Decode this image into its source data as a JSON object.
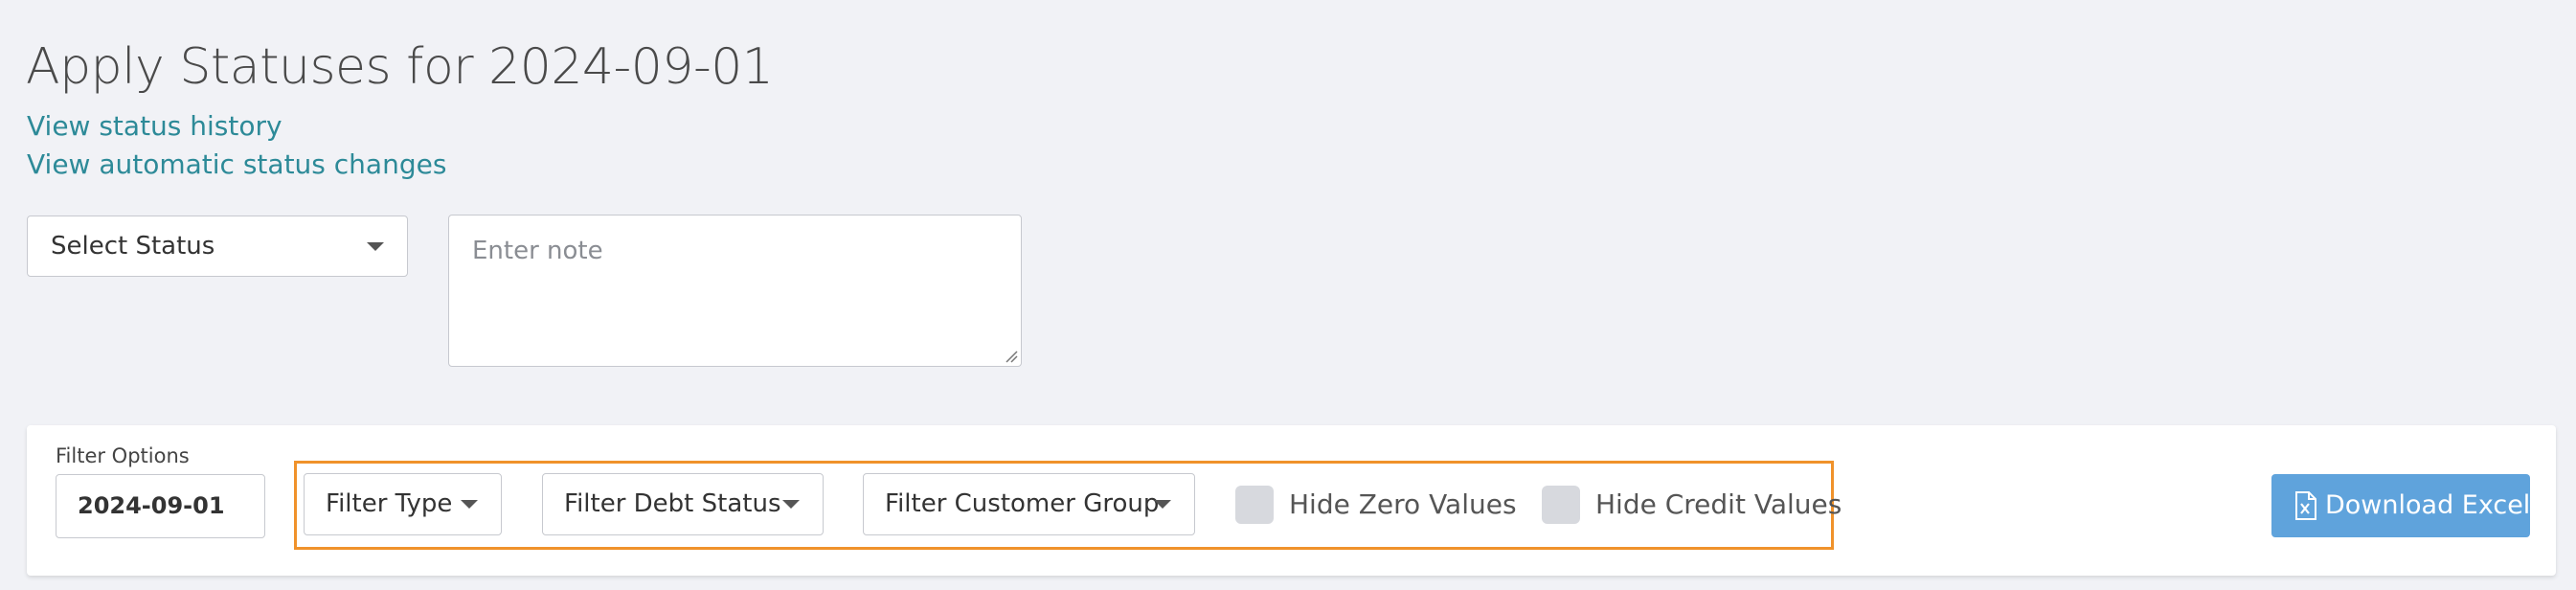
{
  "header": {
    "title": "Apply Statuses for 2024-09-01",
    "links": {
      "status_history": "View status history",
      "automatic_changes": "View automatic status changes"
    }
  },
  "status_form": {
    "status_select_label": "Select Status",
    "note_placeholder": "Enter note"
  },
  "filters": {
    "label": "Filter Options",
    "date_value": "2024-09-01",
    "filter_type_label": "Filter Type",
    "filter_debt_status_label": "Filter Debt Status",
    "filter_customer_group_label": "Filter Customer Group",
    "hide_zero_label": "Hide Zero Values",
    "hide_zero_checked": false,
    "hide_credit_label": "Hide Credit Values",
    "hide_credit_checked": false,
    "download_label": "Download Excel"
  },
  "colors": {
    "link": "#2d8a98",
    "highlight": "#f0922b",
    "download_button": "#5fa3dc",
    "background": "#f1f2f6"
  },
  "icons": {
    "caret": "chevron-down-icon",
    "download": "excel-file-icon"
  }
}
